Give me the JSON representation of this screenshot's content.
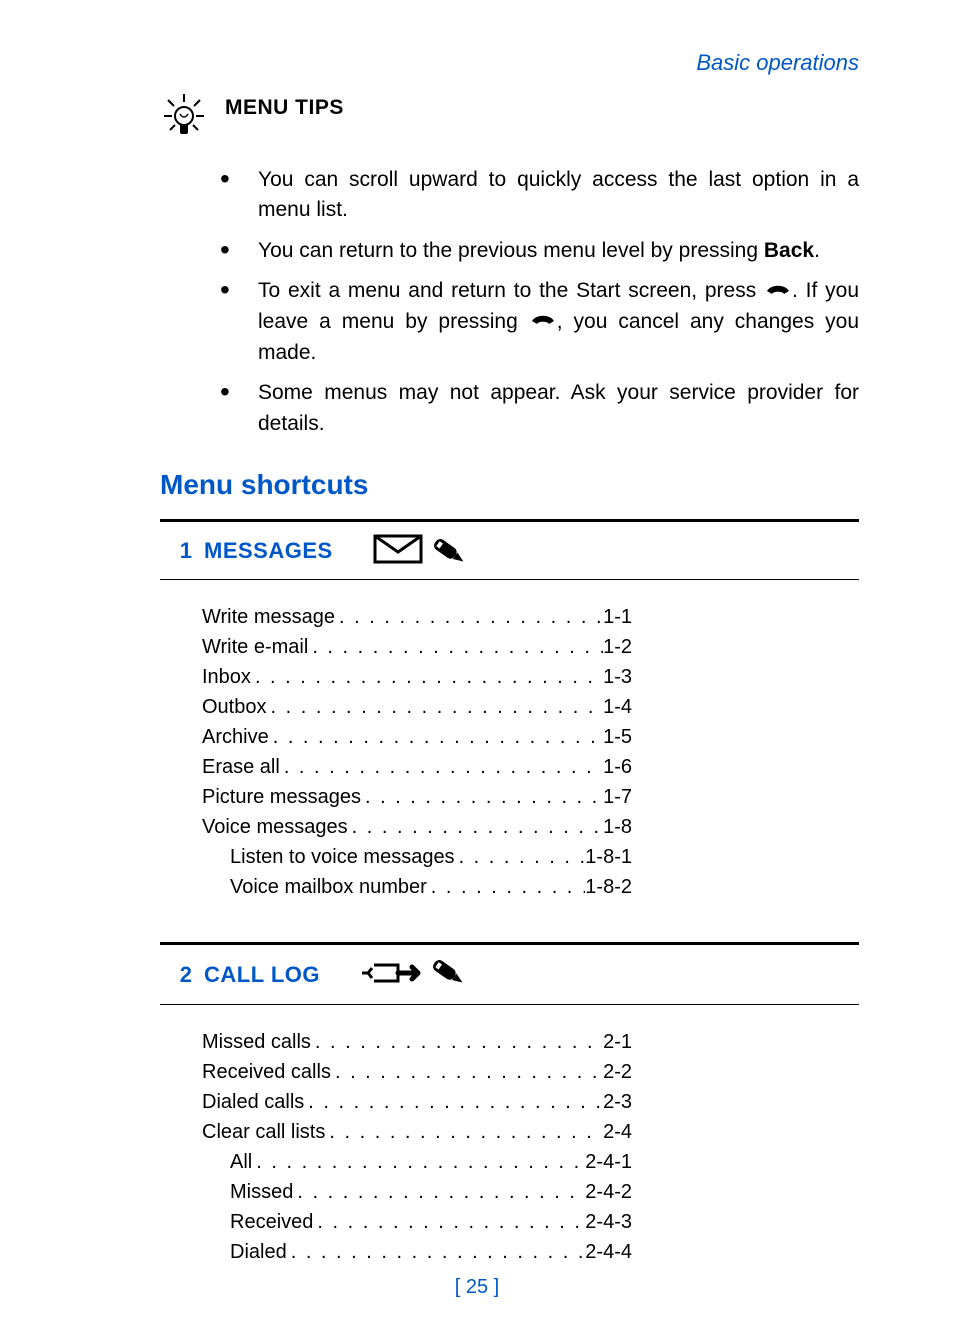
{
  "header": {
    "section": "Basic operations"
  },
  "tips": {
    "title": "MENU TIPS",
    "items": [
      {
        "text": "You can scroll upward to quickly access the last option in a menu list."
      },
      {
        "pre": "You can return to the previous menu level by pressing ",
        "bold": "Back",
        "post": "."
      },
      {
        "pre": "To exit a menu and return to the Start screen, press ",
        "mid": ". If you leave a menu by pressing ",
        "post": ", you cancel any changes you made."
      },
      {
        "text": "Some menus may not appear. Ask your service provider for details."
      }
    ]
  },
  "heading": "Menu shortcuts",
  "menus": [
    {
      "num": "1",
      "title": "MESSAGES",
      "icon": "messages",
      "items": [
        {
          "label": "Write message",
          "ref": "1-1"
        },
        {
          "label": "Write e-mail",
          "ref": "1-2"
        },
        {
          "label": "Inbox",
          "ref": "1-3"
        },
        {
          "label": "Outbox",
          "ref": "1-4"
        },
        {
          "label": "Archive",
          "ref": "1-5"
        },
        {
          "label": "Erase all",
          "ref": "1-6"
        },
        {
          "label": "Picture messages",
          "ref": "1-7"
        },
        {
          "label": "Voice messages",
          "ref": "1-8"
        },
        {
          "label": "Listen to voice messages",
          "ref": "1-8-1",
          "sub": true
        },
        {
          "label": "Voice mailbox number",
          "ref": "1-8-2",
          "sub": true
        }
      ]
    },
    {
      "num": "2",
      "title": "CALL LOG",
      "icon": "calllog",
      "items": [
        {
          "label": "Missed calls",
          "ref": "2-1"
        },
        {
          "label": "Received calls",
          "ref": "2-2"
        },
        {
          "label": "Dialed calls",
          "ref": "2-3"
        },
        {
          "label": "Clear call lists",
          "ref": "2-4"
        },
        {
          "label": "All",
          "ref": "2-4-1",
          "sub": true
        },
        {
          "label": "Missed",
          "ref": "2-4-2",
          "sub": true
        },
        {
          "label": "Received",
          "ref": "2-4-3",
          "sub": true
        },
        {
          "label": "Dialed",
          "ref": "2-4-4",
          "sub": true
        }
      ]
    }
  ],
  "page_number": "[ 25 ]"
}
